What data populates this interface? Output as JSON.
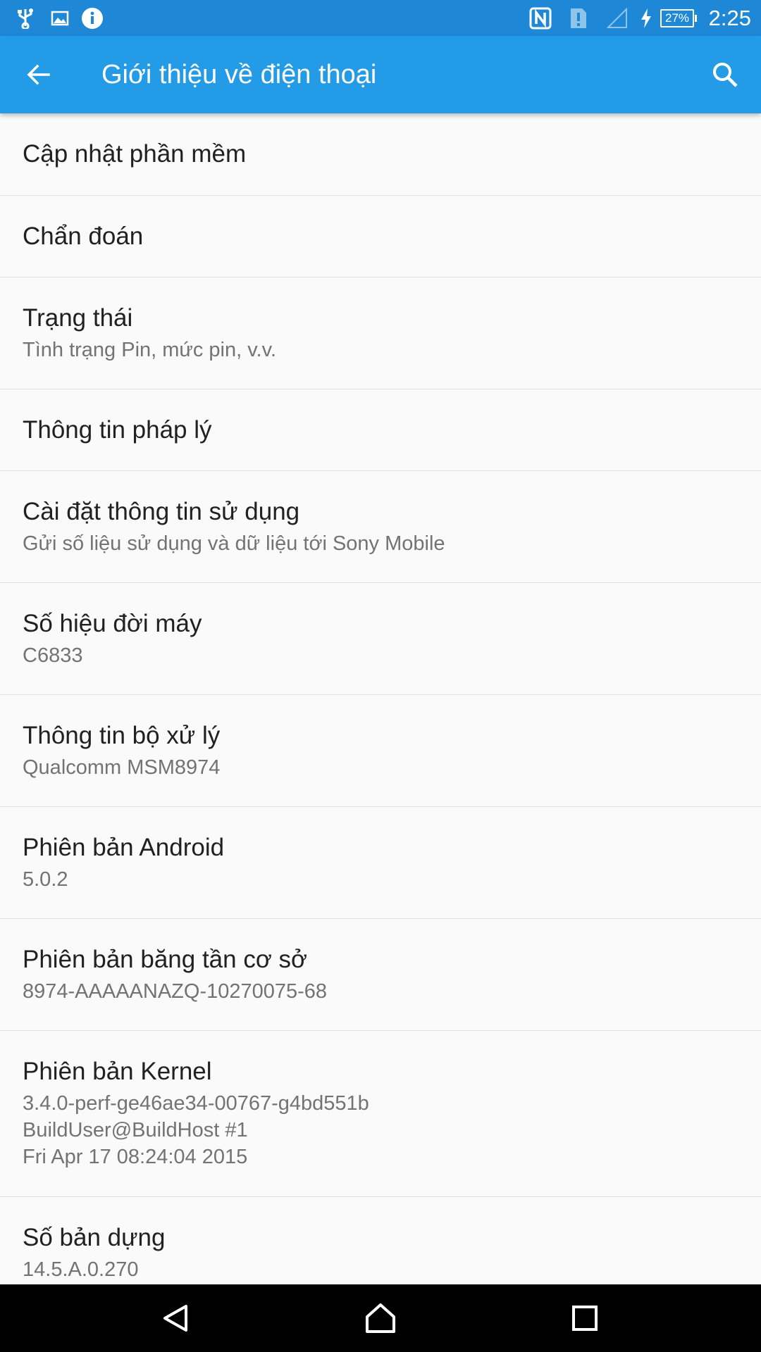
{
  "status_bar": {
    "time": "2:25",
    "battery": "27%",
    "icons": [
      "usb-icon",
      "image-icon",
      "info-icon",
      "nfc-icon",
      "sim-alert-icon",
      "signal-icon",
      "charging-icon"
    ]
  },
  "app_bar": {
    "title": "Giới thiệu về điện thoại",
    "color": "#239be6"
  },
  "settings": [
    {
      "title": "Cập nhật phần mềm",
      "summary": ""
    },
    {
      "title": "Chẩn đoán",
      "summary": ""
    },
    {
      "title": "Trạng thái",
      "summary": "Tình trạng Pin, mức pin, v.v."
    },
    {
      "title": "Thông tin pháp lý",
      "summary": ""
    },
    {
      "title": "Cài đặt thông tin sử dụng",
      "summary": "Gửi số liệu sử dụng và dữ liệu tới Sony Mobile"
    },
    {
      "title": "Số hiệu đời máy",
      "summary": "C6833"
    },
    {
      "title": "Thông tin bộ xử lý",
      "summary": "Qualcomm MSM8974"
    },
    {
      "title": "Phiên bản Android",
      "summary": "5.0.2"
    },
    {
      "title": "Phiên bản băng tần cơ sở",
      "summary": "8974-AAAAANAZQ-10270075-68"
    },
    {
      "title": "Phiên bản Kernel",
      "summary": "3.4.0-perf-ge46ae34-00767-g4bd551b\nBuildUser@BuildHost #1\nFri Apr 17 08:24:04 2015"
    },
    {
      "title": "Số bản dựng",
      "summary": "14.5.A.0.270"
    }
  ],
  "nav_bar": {
    "buttons": [
      "back-icon",
      "home-icon",
      "recents-icon"
    ]
  }
}
